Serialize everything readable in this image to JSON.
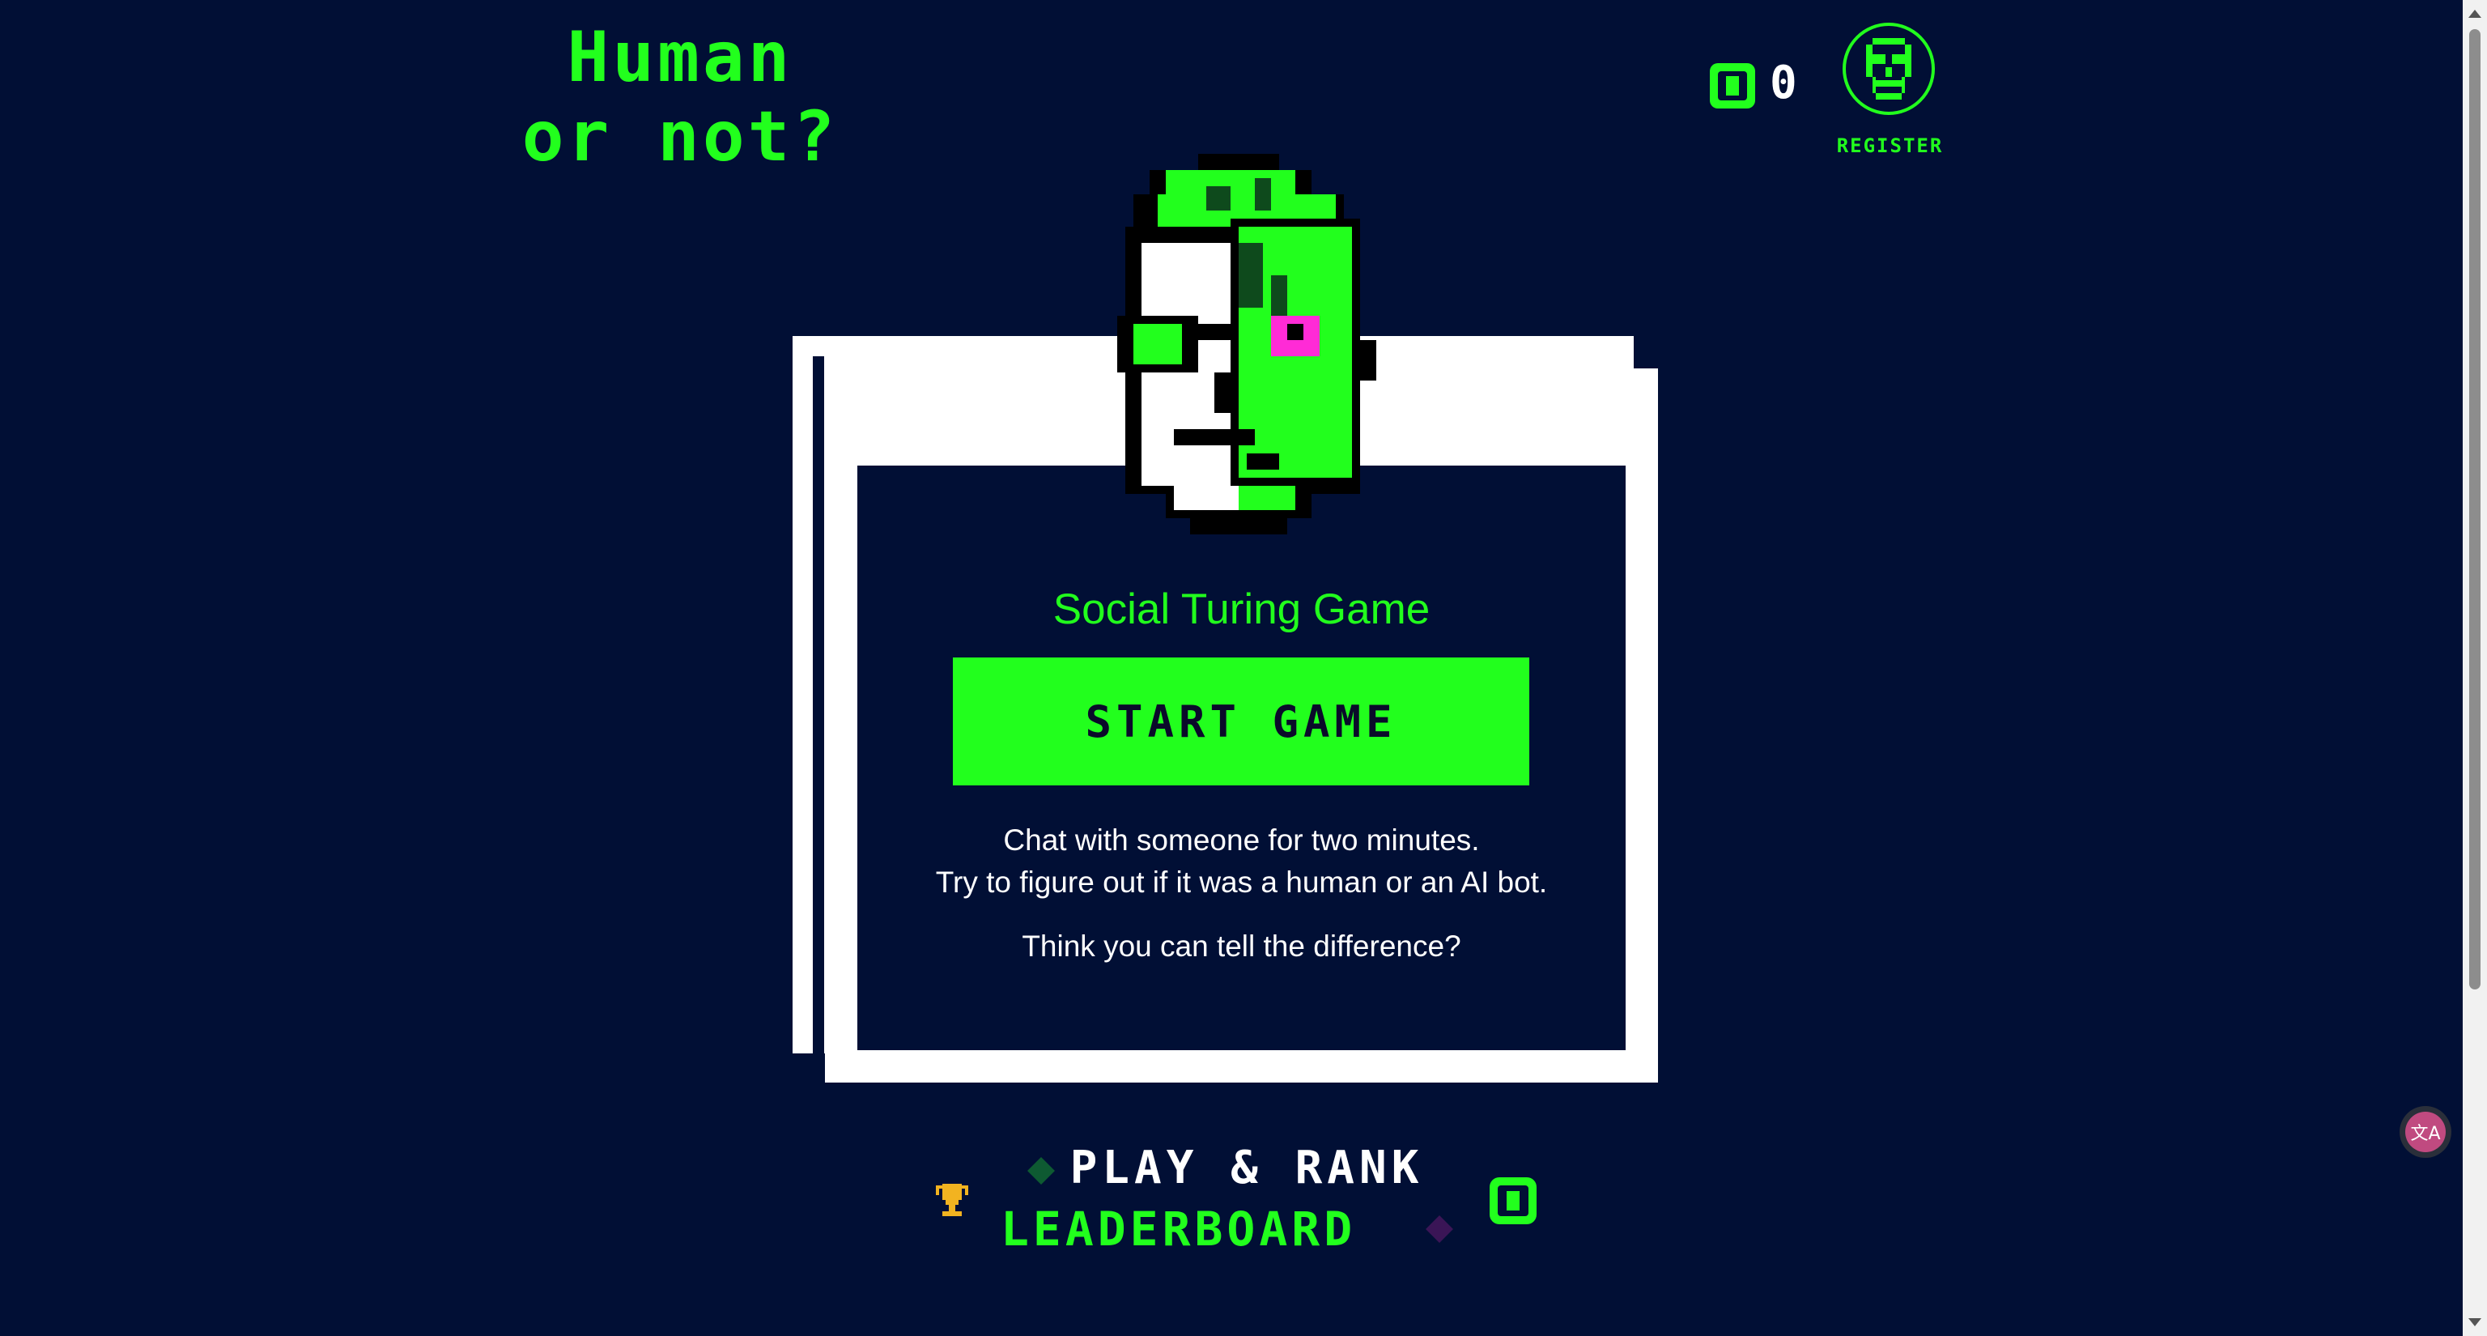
{
  "logo": {
    "line1": "Human",
    "line2": "or not?"
  },
  "header": {
    "coin_count": "0",
    "register_label": "REGISTER"
  },
  "main": {
    "subtitle": "Social Turing Game",
    "start_button": "START GAME",
    "description_line1": "Chat with someone for two minutes.",
    "description_line2": "Try to figure out if it was a human or an AI bot.",
    "question": "Think you can tell the difference?"
  },
  "bottom": {
    "play_rank": "PLAY & RANK",
    "leaderboard": "LEADERBOARD"
  },
  "colors": {
    "background": "#010f35",
    "accent": "#22ff1d",
    "frame": "#ffffff",
    "eye": "#ff2bd6"
  },
  "icons": {
    "coin": "coin-icon",
    "avatar": "robot-avatar-icon",
    "trophy": "trophy-icon",
    "translate": "translate-icon"
  }
}
